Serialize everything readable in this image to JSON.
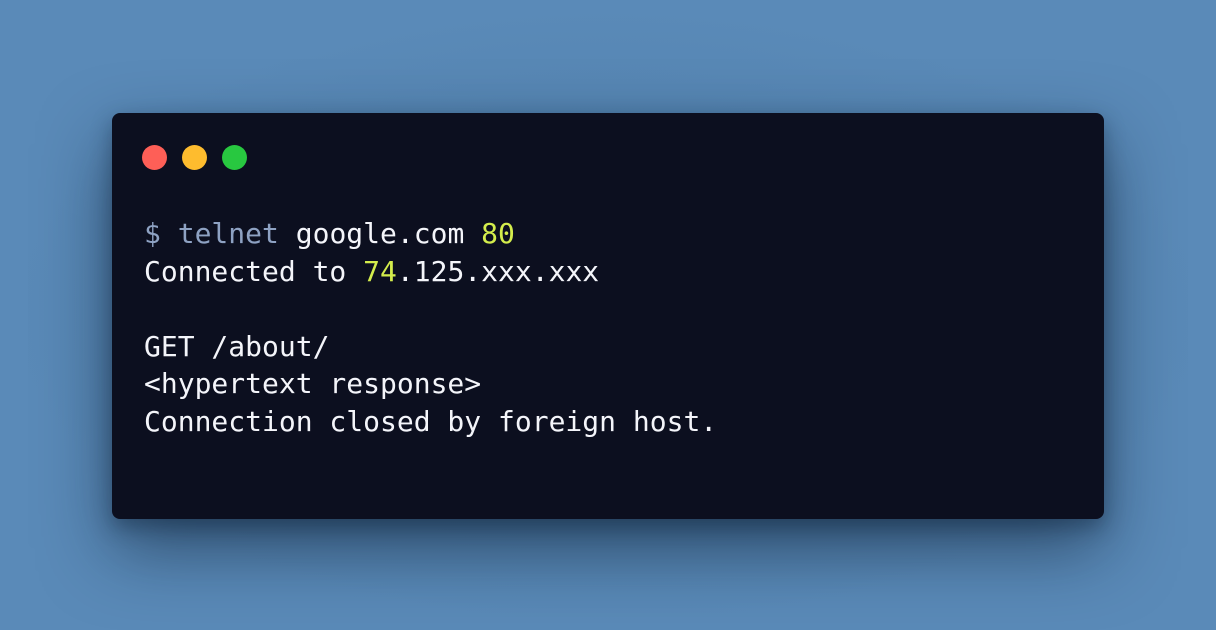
{
  "colors": {
    "background": "#5a8ab8",
    "window": "#0c0f1f",
    "text": "#f4f5fa",
    "muted": "#8ea2c3",
    "highlight": "#d4ed4c",
    "close": "#fe5f57",
    "minimize": "#febc2e",
    "maximize": "#28c840"
  },
  "window": {
    "controls": [
      {
        "name": "close",
        "color": "#fe5f57"
      },
      {
        "name": "minimize",
        "color": "#febc2e"
      },
      {
        "name": "maximize",
        "color": "#28c840"
      }
    ]
  },
  "terminal": {
    "line1": {
      "prompt": "$",
      "command": "telnet",
      "host": "google.com",
      "port": "80"
    },
    "line2": {
      "prefix": "Connected to",
      "ip_highlight": "74",
      "ip_rest": ".125.xxx.xxx"
    },
    "line3": "GET /about/",
    "line4": "<hypertext response>",
    "line5": "Connection closed by foreign host."
  }
}
